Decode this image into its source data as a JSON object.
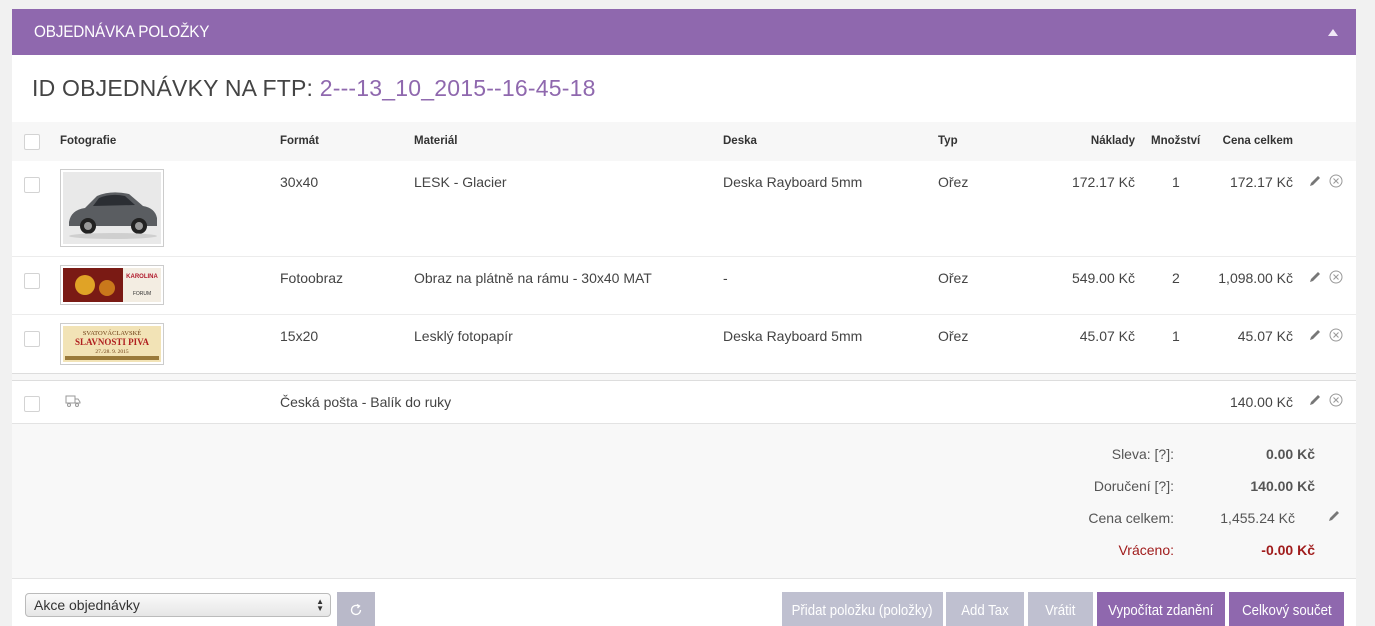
{
  "panel": {
    "title": "OBJEDNÁVKA POLOŽKY",
    "order_id_label": "ID OBJEDNÁVKY NA FTP:",
    "order_id_value": "2---13_10_2015--16-45-18"
  },
  "table": {
    "headers": {
      "photo": "Fotografie",
      "format": "Formát",
      "material": "Materiál",
      "board": "Deska",
      "type": "Typ",
      "cost": "Náklady",
      "qty": "Množství",
      "total": "Cena celkem"
    },
    "rows": [
      {
        "photo": "car-photo",
        "format": "30x40",
        "material": "LESK - Glacier",
        "board": "Deska Rayboard 5mm",
        "type": "Ořez",
        "cost": "172.17 Kč",
        "qty": "1",
        "total": "172.17 Kč"
      },
      {
        "photo": "karolina-banner",
        "format": "Fotoobraz",
        "material": "Obraz na plátně na rámu - 30x40 MAT",
        "board": "-",
        "type": "Ořez",
        "cost": "549.00 Kč",
        "qty": "2",
        "total": "1,098.00 Kč"
      },
      {
        "photo": "slavnosti-piva-banner",
        "format": "15x20",
        "material": "Lesklý fotopapír",
        "board": "Deska Rayboard 5mm",
        "type": "Ořez",
        "cost": "45.07 Kč",
        "qty": "1",
        "total": "45.07 Kč"
      }
    ],
    "shipping": {
      "icon": "truck-icon",
      "label": "Česká pošta - Balík do ruky",
      "total": "140.00 Kč"
    },
    "thumb_text": {
      "karolina_title": "KAROLINA",
      "karolina_brand": "FORUM",
      "slavnosti_line1": "SVATOVÁCLAVSKÉ",
      "slavnosti_line2": "SLAVNOSTI PIVA",
      "slavnosti_date": "27./28. 9. 2015"
    }
  },
  "totals": {
    "discount_label": "Sleva: [?]:",
    "discount_value": "0.00 Kč",
    "delivery_label": "Doručení [?]:",
    "delivery_value": "140.00 Kč",
    "total_label": "Cena celkem:",
    "total_value": "1,455.24 Kč",
    "refunded_label": "Vráceno:",
    "refunded_value": "-0.00 Kč"
  },
  "footer": {
    "select_value": "Akce objednávky",
    "buttons": {
      "add_item": "Přidat položku (položky)",
      "add_tax": "Add Tax",
      "refund": "Vrátit",
      "calc_tax": "Vypočítat zdanění",
      "grand_total": "Celkový součet"
    }
  },
  "colors": {
    "accent": "#8f68ae",
    "refund_red": "#a01c1c",
    "button_gray": "#bfc0d0"
  }
}
